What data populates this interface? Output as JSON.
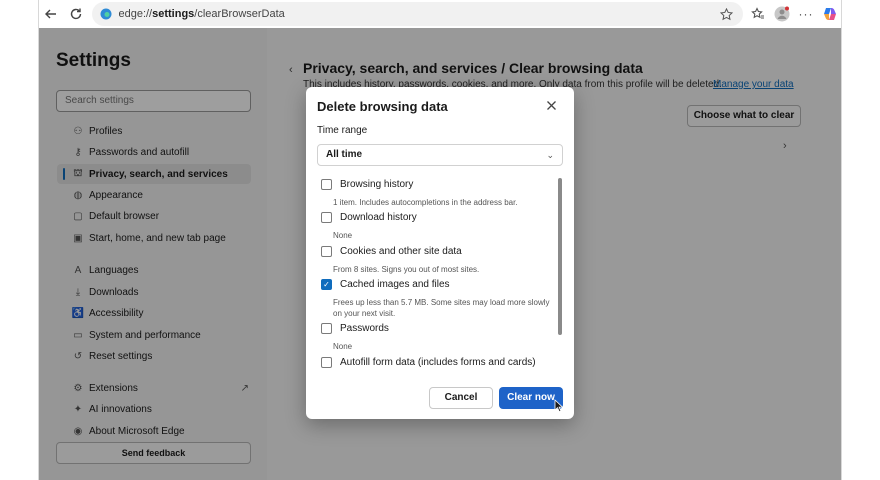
{
  "browser": {
    "url_prefix": "edge://",
    "url_bold": "settings",
    "url_suffix": "/clearBrowserData"
  },
  "sidebar": {
    "title": "Settings",
    "search_placeholder": "Search settings",
    "items": [
      {
        "label": "Profiles",
        "icon": "profile-icon"
      },
      {
        "label": "Passwords and autofill",
        "icon": "key-icon"
      },
      {
        "label": "Privacy, search, and services",
        "icon": "lock-icon",
        "active": true
      },
      {
        "label": "Appearance",
        "icon": "palette-icon"
      },
      {
        "label": "Default browser",
        "icon": "browser-icon"
      },
      {
        "label": "Start, home, and new tab page",
        "icon": "home-page-icon"
      },
      {
        "label": "Languages",
        "icon": "language-icon"
      },
      {
        "label": "Downloads",
        "icon": "download-icon"
      },
      {
        "label": "Accessibility",
        "icon": "accessibility-icon"
      },
      {
        "label": "System and performance",
        "icon": "laptop-icon"
      },
      {
        "label": "Reset settings",
        "icon": "reset-icon"
      },
      {
        "label": "Extensions",
        "icon": "extensions-icon"
      },
      {
        "label": "AI innovations",
        "icon": "ai-icon"
      },
      {
        "label": "About Microsoft Edge",
        "icon": "edge-logo-icon"
      }
    ],
    "send_feedback": "Send feedback"
  },
  "main": {
    "breadcrumb": "Privacy, search, and services / Clear browsing data",
    "description": "This includes history, passwords, cookies, and more. Only data from this profile will be deleted.",
    "manage_link": "Manage your data",
    "choose_button": "Choose what to clear"
  },
  "dialog": {
    "title": "Delete browsing data",
    "time_range_label": "Time range",
    "time_range_value": "All time",
    "options": [
      {
        "label": "Browsing history",
        "desc": "1 item. Includes autocompletions in the address bar.",
        "checked": false
      },
      {
        "label": "Download history",
        "desc": "None",
        "checked": false
      },
      {
        "label": "Cookies and other site data",
        "desc": "From 8 sites. Signs you out of most sites.",
        "checked": false
      },
      {
        "label": "Cached images and files",
        "desc": "Frees up less than 5.7 MB. Some sites may load more slowly on your next visit.",
        "checked": true
      },
      {
        "label": "Passwords",
        "desc": "None",
        "checked": false
      },
      {
        "label": "Autofill form data (includes forms and cards)",
        "desc": "",
        "checked": false
      }
    ],
    "cancel_label": "Cancel",
    "clear_label": "Clear now"
  },
  "colors": {
    "accent": "#0f6cbd",
    "primary_button": "#1e63c8"
  }
}
